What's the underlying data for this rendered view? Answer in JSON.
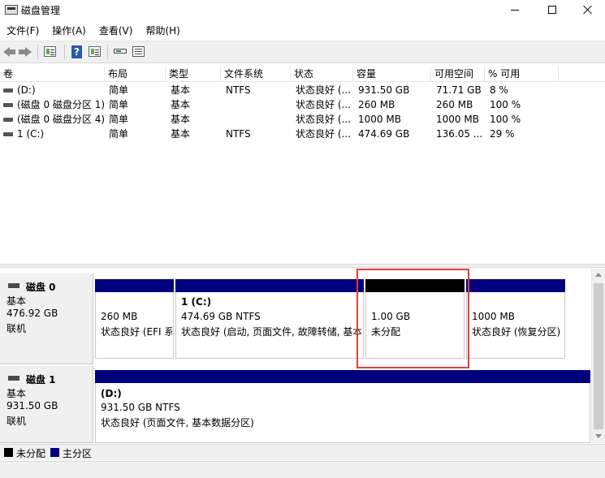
{
  "window": {
    "title": "磁盘管理",
    "icon": "disk-management-icon"
  },
  "menu": [
    "文件(F)",
    "操作(A)",
    "查看(V)",
    "帮助(H)"
  ],
  "toolbar": {
    "icons": [
      "back-arrow-icon",
      "forward-arrow-icon",
      "properties-icon",
      "help-icon",
      "view-icon",
      "connect-disk-icon",
      "rescan-icon"
    ],
    "help_glyph": "?"
  },
  "volume_list": {
    "columns": [
      "卷",
      "布局",
      "类型",
      "文件系统",
      "状态",
      "容量",
      "可用空间",
      "% 可用"
    ],
    "rows": [
      [
        "(D:)",
        "简单",
        "基本",
        "NTFS",
        "状态良好 (...",
        "931.50 GB",
        "71.71 GB",
        "8 %"
      ],
      [
        "(磁盘 0 磁盘分区 1)",
        "简单",
        "基本",
        "",
        "状态良好 (...",
        "260 MB",
        "260 MB",
        "100 %"
      ],
      [
        "(磁盘 0 磁盘分区 4)",
        "简单",
        "基本",
        "",
        "状态良好 (...",
        "1000 MB",
        "1000 MB",
        "100 %"
      ],
      [
        "1 (C:)",
        "简单",
        "基本",
        "NTFS",
        "状态良好 (...",
        "474.69 GB",
        "136.05 ...",
        "29 %"
      ]
    ]
  },
  "disks": [
    {
      "name": "磁盘 0",
      "type": "基本",
      "size": "476.92 GB",
      "status": "联机",
      "partitions": [
        {
          "title": "",
          "size": "260 MB",
          "status": "状态良好 (EFI 系",
          "bar_color": "#00007f"
        },
        {
          "title": "1  (C:)",
          "size": "474.69 GB NTFS",
          "status": "状态良好 (启动, 页面文件, 故障转储, 基本",
          "bar_color": "#00007f"
        },
        {
          "title": "",
          "size": "1.00 GB",
          "status": "未分配",
          "bar_color": "#000000"
        },
        {
          "title": "",
          "size": "1000 MB",
          "status": "状态良好 (恢复分区)",
          "bar_color": "#00007f"
        }
      ]
    },
    {
      "name": "磁盘 1",
      "type": "基本",
      "size": "931.50 GB",
      "status": "联机",
      "partitions": [
        {
          "title": "(D:)",
          "size": "931.50 GB NTFS",
          "status": "状态良好 (页面文件, 基本数据分区)",
          "bar_color": "#00007f"
        }
      ]
    }
  ],
  "legend": [
    {
      "label": "未分配",
      "color": "#000000"
    },
    {
      "label": "主分区",
      "color": "#00007f"
    }
  ],
  "colors": {
    "highlight": "#e04040"
  }
}
